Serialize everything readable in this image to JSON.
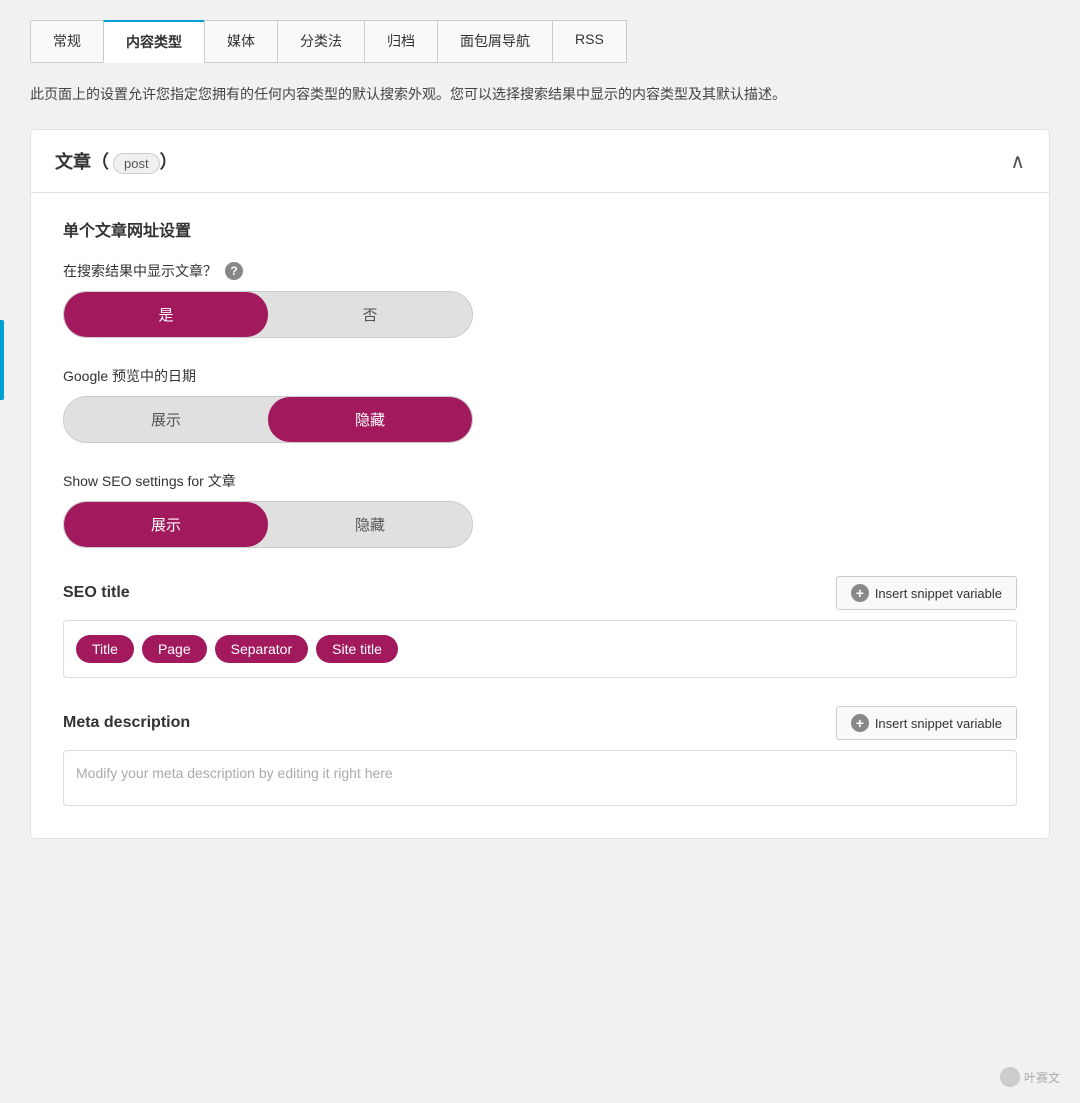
{
  "tabs": [
    {
      "id": "general",
      "label": "常规",
      "active": false
    },
    {
      "id": "content-type",
      "label": "内容类型",
      "active": true
    },
    {
      "id": "media",
      "label": "媒体",
      "active": false
    },
    {
      "id": "taxonomy",
      "label": "分类法",
      "active": false
    },
    {
      "id": "archive",
      "label": "归档",
      "active": false
    },
    {
      "id": "breadcrumb",
      "label": "面包屑导航",
      "active": false
    },
    {
      "id": "rss",
      "label": "RSS",
      "active": false
    }
  ],
  "description": "此页面上的设置允许您指定您拥有的任何内容类型的默认搜索外观。您可以选择搜索结果中显示的内容类型及其默认描述。",
  "section": {
    "title": "文章（",
    "badge": "post",
    "title_suffix": "）",
    "collapse_icon": "∧"
  },
  "sub_section_title": "单个文章网址设置",
  "field_show_in_search": {
    "label": "在搜索结果中显示文章？",
    "yes_label": "是",
    "no_label": "否",
    "active": "yes"
  },
  "field_google_date": {
    "label": "Google 预览中的日期",
    "show_label": "展示",
    "hide_label": "隐藏",
    "active": "hide"
  },
  "field_show_seo": {
    "label": "Show SEO settings for 文章",
    "show_label": "展示",
    "hide_label": "隐藏",
    "active": "show"
  },
  "seo_title": {
    "label": "SEO title",
    "insert_btn": "Insert snippet variable",
    "tags": [
      {
        "id": "title",
        "label": "Title"
      },
      {
        "id": "page",
        "label": "Page"
      },
      {
        "id": "separator",
        "label": "Separator"
      },
      {
        "id": "site-title",
        "label": "Site title"
      }
    ]
  },
  "meta_description": {
    "label": "Meta description",
    "insert_btn": "Insert snippet variable",
    "placeholder": "Modify your meta description by editing it right here"
  },
  "watermark": "叶赛文"
}
